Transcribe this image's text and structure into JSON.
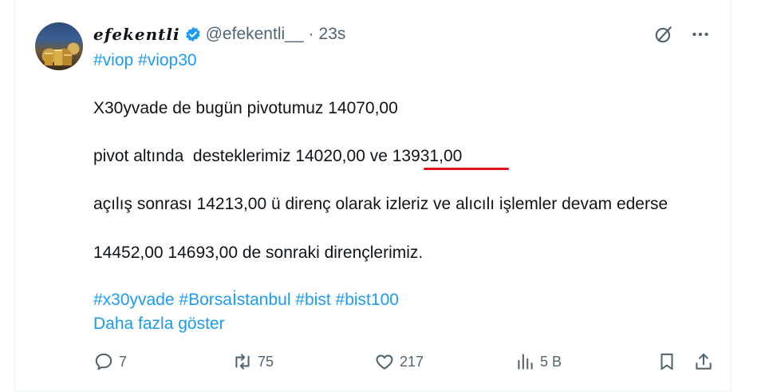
{
  "tweet": {
    "author": {
      "display_name": "efekentli",
      "handle": "@efekentli__",
      "separator": "·",
      "time": "23s"
    },
    "hashtags_top": "#viop #viop30",
    "lines": [
      "X30yvade de bugün pivotumuz 14070,00",
      "pivot altında  desteklerimiz 14020,00 ve 13931,00",
      "açılış sonrası 14213,00 ü direnç olarak izleriz ve alıcılı işlemler devam ederse",
      "14452,00 14693,00 de sonraki dirençlerimiz."
    ],
    "hashtags_bottom": "#x30yvade #Borsaİstanbul #bist #bist100",
    "show_more": "Daha fazla göster"
  },
  "actions": {
    "reply_count": "7",
    "retweet_count": "75",
    "like_count": "217",
    "views_count": "5 B"
  },
  "icons": {
    "verified": "verified-badge-icon",
    "grok": "grok-icon",
    "more": "more-icon",
    "reply": "reply-icon",
    "retweet": "retweet-icon",
    "like": "heart-icon",
    "views": "views-icon",
    "bookmark": "bookmark-icon",
    "share": "share-icon"
  },
  "colors": {
    "link": "#1d9bf0",
    "muted": "#536471",
    "annotation": "#e0141e"
  }
}
